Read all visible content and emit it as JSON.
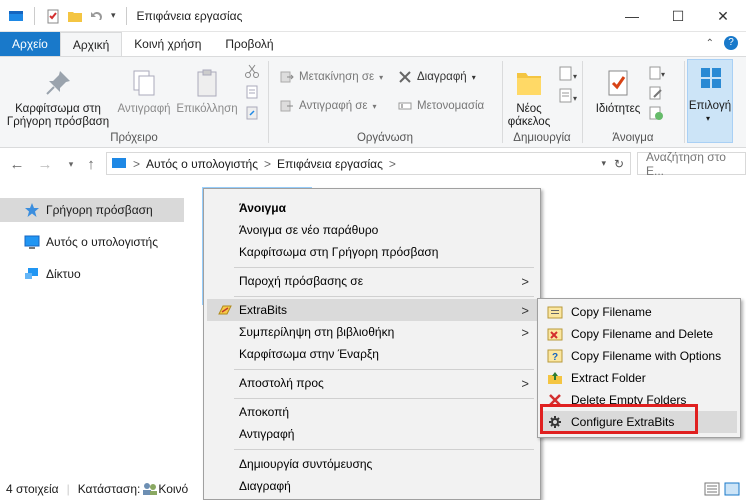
{
  "titlebar": {
    "title": "Επιφάνεια εργασίας",
    "minimize": "—",
    "maximize": "☐",
    "close": "✕"
  },
  "tabs": [
    {
      "label": "Αρχείο"
    },
    {
      "label": "Αρχική"
    },
    {
      "label": "Κοινή χρήση"
    },
    {
      "label": "Προβολή"
    }
  ],
  "ribbon": {
    "clipboard": {
      "pin": "Καρφίτσωμα στη Γρήγορη πρόσβαση",
      "copy": "Αντιγραφή",
      "paste": "Επικόλληση",
      "label": "Πρόχειρο"
    },
    "organize": {
      "move": "Μετακίνηση σε",
      "copyto": "Αντιγραφή σε",
      "delete": "Διαγραφή",
      "rename": "Μετονομασία",
      "label": "Οργάνωση"
    },
    "new": {
      "folder": "Νέος φάκελος",
      "label": "Δημιουργία"
    },
    "open": {
      "properties": "Ιδιότητες",
      "label": "Άνοιγμα"
    },
    "select": {
      "label": "Επιλογή"
    }
  },
  "address": {
    "path": [
      "Αυτός ο υπολογιστής",
      "Επιφάνεια εργασίας"
    ],
    "sep": ">",
    "search_placeholder": "Αναζήτηση στο Ε..."
  },
  "navpane": {
    "items": [
      {
        "label": "Γρήγορη πρόσβαση"
      },
      {
        "label": "Αυτός ο υπολογιστής"
      },
      {
        "label": "Δίκτυο"
      }
    ]
  },
  "status": {
    "count": "4 στοιχεία",
    "state": "Κατάσταση:",
    "state_value": "Κοινό"
  },
  "context_menu": {
    "items": [
      {
        "label": "Άνοιγμα"
      },
      {
        "label": "Άνοιγμα σε νέο παράθυρο"
      },
      {
        "label": "Καρφίτσωμα στη Γρήγορη πρόσβαση"
      },
      {
        "label": "Παροχή πρόσβασης σε"
      },
      {
        "label": "ExtraBits"
      },
      {
        "label": "Συμπερίληψη στη βιβλιοθήκη"
      },
      {
        "label": "Καρφίτσωμα στην Έναρξη"
      },
      {
        "label": "Αποστολή προς"
      },
      {
        "label": "Αποκοπή"
      },
      {
        "label": "Αντιγραφή"
      },
      {
        "label": "Δημιουργία συντόμευσης"
      },
      {
        "label": "Διαγραφή"
      }
    ],
    "arrow": ">"
  },
  "submenu": {
    "items": [
      {
        "label": "Copy Filename"
      },
      {
        "label": "Copy Filename and Delete"
      },
      {
        "label": "Copy Filename with Options"
      },
      {
        "label": "Extract Folder"
      },
      {
        "label": "Delete Empty Folders"
      },
      {
        "label": "Configure ExtraBits"
      }
    ]
  },
  "colors": {
    "accent": "#1979ca",
    "highlight": "#e02020",
    "selection": "#cce8ff"
  }
}
